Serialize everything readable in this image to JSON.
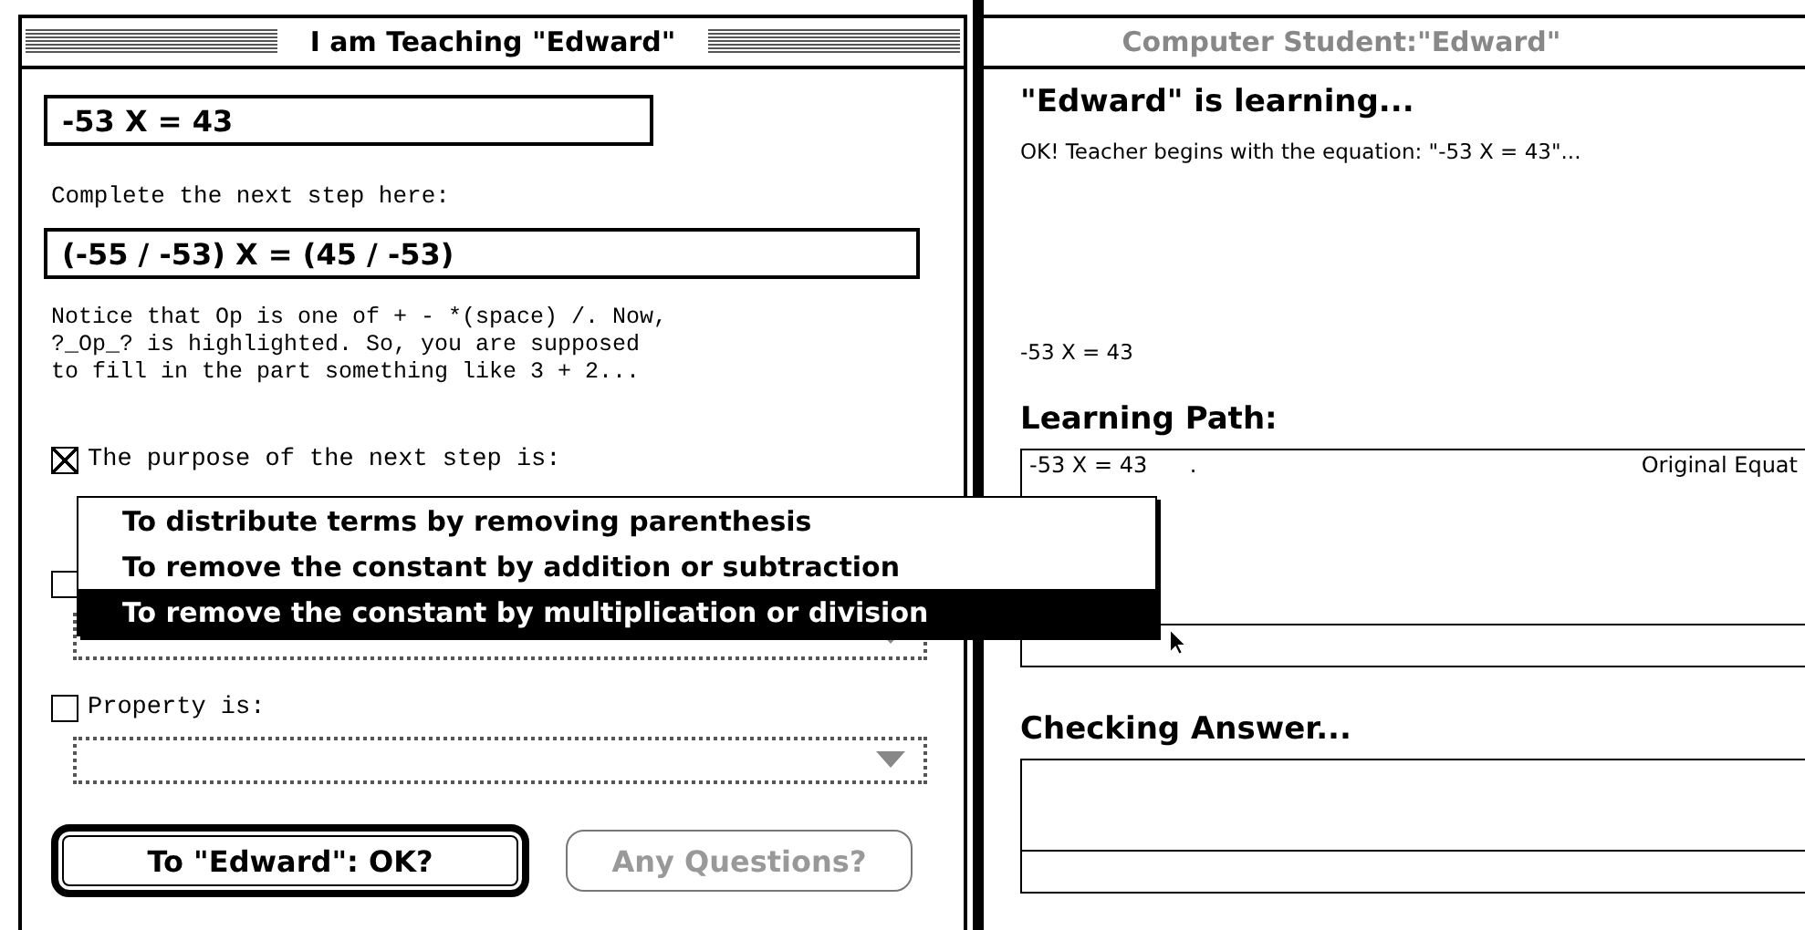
{
  "teacher_window": {
    "title": "I am Teaching \"Edward\"",
    "active": true,
    "equation_field": {
      "value": "-53 X = 43"
    },
    "step_label": "Complete the next step here:",
    "step_field": {
      "value": "(-55 / -53) X = (45 / -53)"
    },
    "hint": [
      "Notice that Op is one of + - *(space) /. Now,",
      "?_Op_? is highlighted. So, you are supposed",
      "to fill in the part something like 3 + 2..."
    ],
    "options": [
      {
        "label": "The purpose of the next step is:",
        "checked": true
      },
      {
        "checked": false,
        "popup": {
          "disabled": true
        }
      },
      {
        "label": "Property is:",
        "checked": false,
        "popup": {
          "disabled": true
        }
      }
    ],
    "buttons": [
      {
        "label": "To \"Edward\": OK?",
        "default": true,
        "disabled": false
      },
      {
        "label": "Any Questions?",
        "default": false,
        "disabled": true
      }
    ]
  },
  "popup_menu": {
    "items": [
      {
        "label": "To distribute terms by removing parenthesis",
        "selected": false
      },
      {
        "label": "To remove the constant by addition or subtraction",
        "selected": false
      },
      {
        "label": "To remove the constant by multiplication or division",
        "selected": true
      }
    ]
  },
  "student_window": {
    "title": "Computer Student:\"Edward\"",
    "active": false,
    "heading": "\"Edward\" is learning...",
    "message": "OK! Teacher begins with the equation: \"-53 X = 43\"...",
    "current_equation": "-53 X = 43",
    "path_heading": "Learning Path:",
    "path_rows": [
      {
        "equation": "-53 X = 43",
        "column_2": ".",
        "note": "Original Equat"
      }
    ],
    "checking_heading": "Checking Answer..."
  }
}
